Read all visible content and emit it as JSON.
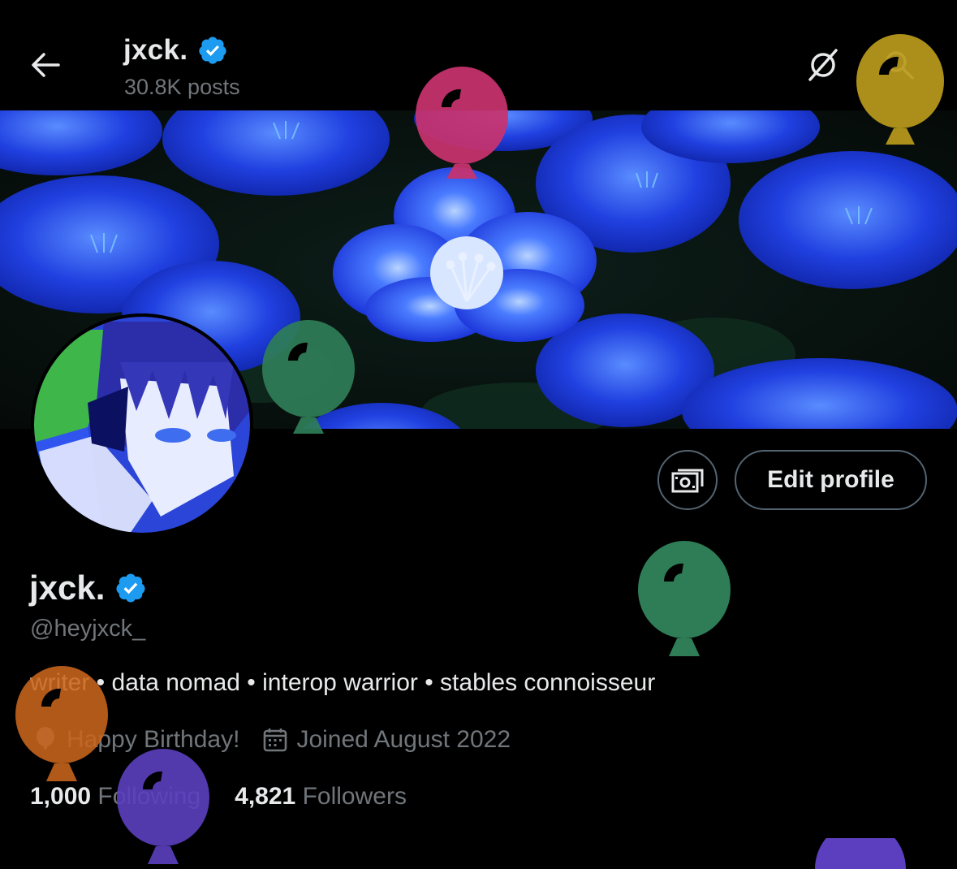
{
  "header": {
    "name": "jxck.",
    "posts": "30.8K posts"
  },
  "profile": {
    "name": "jxck.",
    "handle": "@heyjxck_",
    "bio_parts": [
      "writer",
      " • data nomad • interop warrior • stables connoisseur"
    ],
    "birthday": "Happy Birthday!",
    "joined": "Joined August 2022",
    "following_count": "1,000",
    "following_label": "Following",
    "followers_count": "4,821",
    "followers_label": "Followers"
  },
  "actions": {
    "edit_profile": "Edit profile"
  },
  "colors": {
    "background": "#000000",
    "text": "#e7e9ea",
    "muted": "#71767b",
    "verified": "#1d9bf0",
    "border": "#536471",
    "balloon_pink": "#c8336e",
    "balloon_gold": "#b89a1c",
    "balloon_green": "#2e7d57",
    "balloon_orange": "#c8651c",
    "balloon_purple": "#5b3fbf"
  },
  "icons": [
    "back-arrow-icon",
    "verified-badge-icon",
    "grok-icon",
    "search-icon",
    "money-icon",
    "balloon-icon",
    "calendar-icon"
  ]
}
